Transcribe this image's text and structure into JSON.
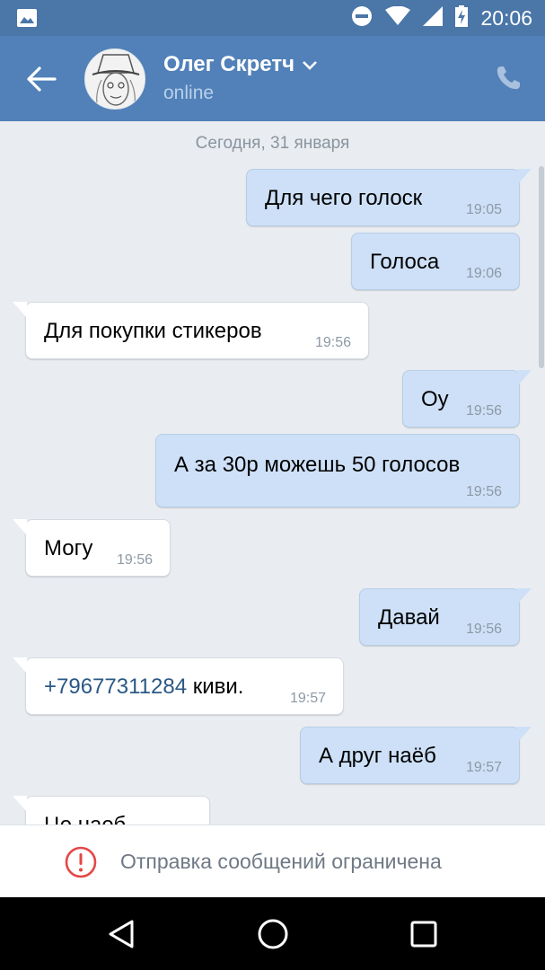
{
  "status_bar": {
    "time": "20:06",
    "icons": [
      "image-icon",
      "do-not-disturb-icon",
      "wifi-icon",
      "signal-icon",
      "battery-charging-icon"
    ]
  },
  "header": {
    "contact_name": "Олег Скретч",
    "status": "online",
    "icons": [
      "back-arrow-icon",
      "chevron-down-icon",
      "phone-icon"
    ]
  },
  "chat": {
    "date_separator": "Сегодня, 31 января",
    "messages": [
      {
        "direction": "out",
        "text": "Для чего голоск",
        "time": "19:05"
      },
      {
        "direction": "out",
        "text": "Голоса",
        "time": "19:06"
      },
      {
        "direction": "in",
        "text": "Для покупки стикеров",
        "time": "19:56"
      },
      {
        "direction": "out",
        "text": "Оу",
        "time": "19:56"
      },
      {
        "direction": "out",
        "text": "А за 30р можешь 50 голосов",
        "time": "19:56"
      },
      {
        "direction": "in",
        "text": "Могу",
        "time": "19:56"
      },
      {
        "direction": "out",
        "text": "Давай",
        "time": "19:56"
      },
      {
        "direction": "in",
        "phone_link": "+79677311284",
        "text": " киви.",
        "time": "19:57"
      },
      {
        "direction": "out",
        "text": "А друг наёб",
        "time": "19:57"
      },
      {
        "direction": "in",
        "text": "Це наеб",
        "time": ""
      }
    ]
  },
  "footer": {
    "restriction_text": "Отправка сообщений ограничена",
    "icon": "alert-circle-icon"
  },
  "nav_bar": {
    "icons": [
      "back-triangle-icon",
      "home-circle-icon",
      "recents-square-icon"
    ]
  },
  "colors": {
    "header": "#5181b8",
    "status_bar": "#4a76a8",
    "outgoing_bubble": "#cde0f7",
    "incoming_bubble": "#ffffff",
    "chat_background": "#e9edf1",
    "link": "#2a5885",
    "alert": "#e64646"
  }
}
